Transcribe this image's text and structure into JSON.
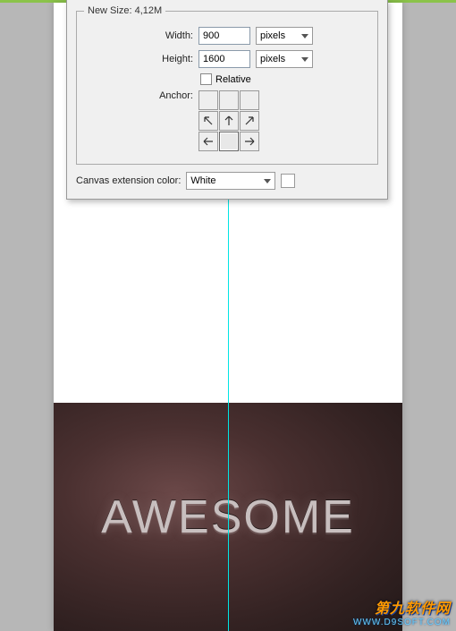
{
  "dialog": {
    "group_title": "New Size: 4,12M",
    "width_label": "Width:",
    "width_value": "900",
    "width_unit": "pixels",
    "height_label": "Height:",
    "height_value": "1600",
    "height_unit": "pixels",
    "relative_label": "Relative",
    "anchor_label": "Anchor:",
    "extension_label": "Canvas extension color:",
    "extension_value": "White"
  },
  "canvas": {
    "artwork_text": "AWESOME"
  },
  "watermark": {
    "line1": "第九软件网",
    "line2": "WWW.D9SOFT.COM"
  }
}
